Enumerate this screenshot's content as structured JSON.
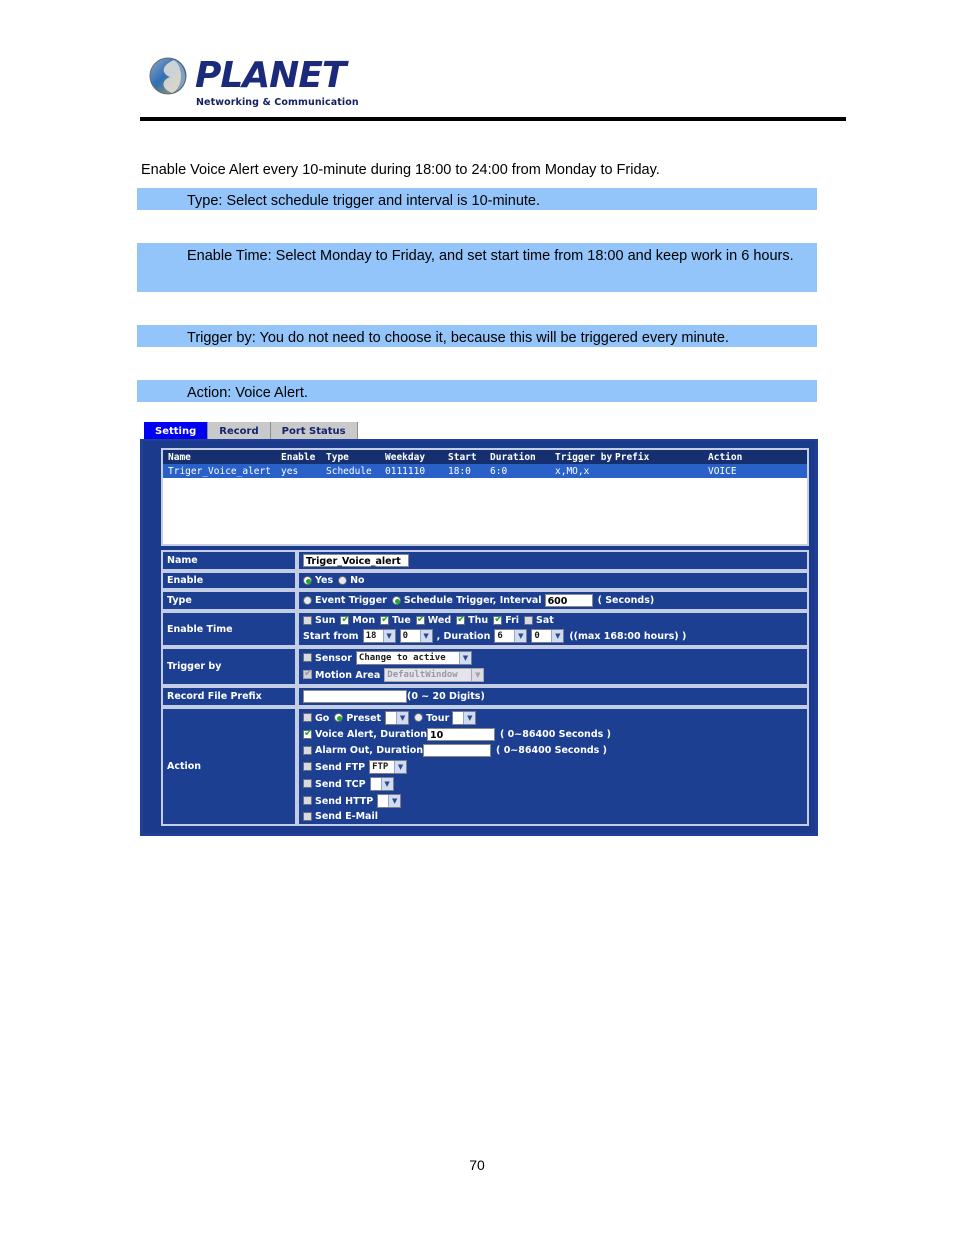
{
  "header": {
    "brand": "PLANET",
    "tagline": "Networking & Communication"
  },
  "intro": "Enable Voice Alert every 10-minute during 18:00 to 24:00 from Monday to Friday.",
  "callouts": {
    "type": "Type: Select schedule trigger and interval is 10-minute.",
    "enable_time": "Enable Time: Select Monday to Friday, and set start time from 18:00 and keep work in 6 hours.",
    "trigger_by": "Trigger by: You do not need to choose it, because this will be triggered every minute.",
    "action": "Action: Voice Alert."
  },
  "device_ui": {
    "tabs": [
      {
        "label": "Setting",
        "active": true
      },
      {
        "label": "Record",
        "active": false
      },
      {
        "label": "Port Status",
        "active": false
      }
    ],
    "list": {
      "columns": [
        "Name",
        "Enable",
        "Type",
        "Weekday",
        "Start",
        "Duration",
        "Trigger by",
        "Prefix",
        "Action"
      ],
      "rows": [
        {
          "name": "Triger_Voice_alert",
          "enable": "yes",
          "type": "Schedule",
          "weekday": "0111110",
          "start": "18:0",
          "duration": "6:0",
          "trigger_by": "x,MO,x",
          "prefix": "",
          "action": "VOICE"
        }
      ]
    },
    "form": {
      "name": {
        "label": "Name",
        "value": "Triger_Voice_alert"
      },
      "enable": {
        "label": "Enable",
        "yes_label": "Yes",
        "no_label": "No",
        "selected": "Yes"
      },
      "type": {
        "label": "Type",
        "event_trigger_label": "Event Trigger",
        "schedule_trigger_label": "Schedule Trigger, Interval",
        "selected": "Schedule Trigger",
        "interval_value": "600",
        "interval_unit": "( Seconds)"
      },
      "enable_time": {
        "label": "Enable Time",
        "days": [
          {
            "label": "Sun",
            "checked": false
          },
          {
            "label": "Mon",
            "checked": true
          },
          {
            "label": "Tue",
            "checked": true
          },
          {
            "label": "Wed",
            "checked": true
          },
          {
            "label": "Thu",
            "checked": true
          },
          {
            "label": "Fri",
            "checked": true
          },
          {
            "label": "Sat",
            "checked": false
          }
        ],
        "start_label": "Start from",
        "start_hour": "18",
        "start_minute": "0",
        "duration_label": ", Duration",
        "duration_hour": "6",
        "duration_minute": "0",
        "max_note": "((max 168:00 hours) )"
      },
      "trigger_by": {
        "label": "Trigger by",
        "sensor_label": "Sensor",
        "sensor_checked": false,
        "sensor_value": "Change to active",
        "motion_label": "Motion Area",
        "motion_checked": true,
        "motion_disabled": true,
        "motion_value": "DefaultWindow"
      },
      "record_file_prefix": {
        "label": "Record File Prefix",
        "value": "",
        "hint": "(0 ~ 20 Digits)"
      },
      "action": {
        "label": "Action",
        "go_label": "Go",
        "go_checked": false,
        "preset_label": "Preset",
        "preset_selected": true,
        "preset_value": "",
        "tour_label": "Tour",
        "tour_selected": false,
        "tour_value": "",
        "voice_label": "Voice Alert, Duration",
        "voice_checked": true,
        "voice_duration": "10",
        "voice_range": "( 0~86400 Seconds )",
        "alarm_label": "Alarm Out, Duration",
        "alarm_checked": false,
        "alarm_duration": "",
        "alarm_range": "( 0~86400 Seconds )",
        "ftp_label": "Send FTP",
        "ftp_checked": false,
        "ftp_value": "FTP",
        "tcp_label": "Send TCP",
        "tcp_checked": false,
        "tcp_value": "",
        "http_label": "Send HTTP",
        "http_checked": false,
        "http_value": "",
        "email_label": "Send E-Mail",
        "email_checked": false
      }
    }
  },
  "page_number": "70"
}
